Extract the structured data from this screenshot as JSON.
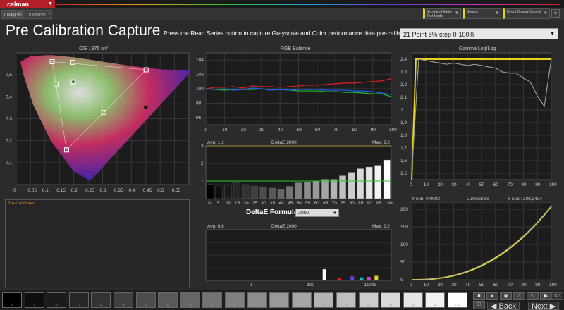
{
  "app": {
    "logo": "calman"
  },
  "tabs": [
    {
      "label": "meleg 40"
    },
    {
      "label": "meleg60"
    }
  ],
  "toolbar": {
    "meter": {
      "line1": "Simulated Meter",
      "line2": "Test Mode"
    },
    "source": {
      "line1": "Source"
    },
    "display": {
      "line1": "Direct Display Control"
    }
  },
  "page": {
    "title": "Pre Calibration Capture",
    "instructions": "Press the Read Series button to capture Grayscale and Color performance data pre-calibration.",
    "series": "21 Point 5% step 0-100%"
  },
  "notes": {
    "label": "Pre-Cal Notes:"
  },
  "formula": {
    "label": "DeltaE Formula",
    "value": "2000"
  },
  "colors": {
    "accent": "#e6d51c",
    "brand": "#b3202a",
    "panel": "#262626"
  },
  "chart_data": [
    {
      "id": "cie",
      "type": "scatter",
      "title": "CIE 1976 u'v'",
      "xlim": [
        0,
        0.6
      ],
      "ylim": [
        0,
        0.6
      ],
      "x_ticks": [
        "0",
        "0,05",
        "0,1",
        "0,15",
        "0,2",
        "0,25",
        "0,3",
        "0,35",
        "0,4",
        "0,45",
        "0,5",
        "0,55"
      ],
      "y_ticks": [
        "0,1",
        "0,2",
        "0,3",
        "0,4",
        "0,5"
      ],
      "targets": [
        {
          "u": 0.125,
          "v": 0.56
        },
        {
          "u": 0.175,
          "v": 0.158
        },
        {
          "u": 0.451,
          "v": 0.523
        },
        {
          "u": 0.197,
          "v": 0.557
        },
        {
          "u": 0.138,
          "v": 0.458
        },
        {
          "u": 0.304,
          "v": 0.329
        },
        {
          "u": 0.198,
          "v": 0.468
        }
      ],
      "white_point": {
        "u": 0.198,
        "v": 0.468
      },
      "measured": [
        {
          "u": 0.45,
          "v": 0.352
        }
      ]
    },
    {
      "id": "rgb",
      "type": "line",
      "title": "RGB Balance",
      "xlim": [
        0,
        100
      ],
      "ylim": [
        95,
        105
      ],
      "x_ticks": [
        "0",
        "10",
        "20",
        "30",
        "40",
        "50",
        "60",
        "70",
        "80",
        "90",
        "100"
      ],
      "y_ticks": [
        "96",
        "98",
        "100",
        "102",
        "104"
      ],
      "x": [
        0,
        5,
        10,
        15,
        20,
        25,
        30,
        35,
        40,
        45,
        50,
        55,
        60,
        65,
        70,
        75,
        80,
        85,
        90,
        95,
        100
      ],
      "series": [
        {
          "color": "#e02020",
          "values": [
            100,
            100.2,
            100.2,
            100.3,
            100.1,
            100.4,
            100.3,
            100.3,
            100.2,
            100.3,
            100.4,
            100.5,
            100.5,
            100.6,
            100.7,
            100.8,
            100.8,
            100.9,
            101.0,
            101.1,
            101.4
          ]
        },
        {
          "color": "#20c020",
          "values": [
            100,
            99.9,
            99.8,
            99.9,
            99.9,
            99.9,
            100.0,
            99.8,
            99.9,
            99.8,
            99.7,
            99.7,
            99.7,
            99.6,
            99.6,
            99.5,
            99.5,
            99.4,
            99.3,
            99.3,
            98.9
          ]
        },
        {
          "color": "#2060ff",
          "values": [
            100,
            99.9,
            100.0,
            99.8,
            99.9,
            100.1,
            100.0,
            99.8,
            99.9,
            99.8,
            99.9,
            99.9,
            99.9,
            99.8,
            99.8,
            99.8,
            99.7,
            99.7,
            99.6,
            99.4,
            99.2
          ]
        }
      ]
    },
    {
      "id": "gray-de",
      "type": "bar",
      "title": "DeltaE 2000",
      "avg_label": "Avg: 1,1",
      "max_label": "Max: 2,2",
      "ylim": [
        0,
        3
      ],
      "threshold": 1,
      "y_ticks": [
        "1",
        "2",
        "3"
      ],
      "categories": [
        "0",
        "5",
        "10",
        "15",
        "20",
        "25",
        "30",
        "35",
        "40",
        "45",
        "50",
        "55",
        "60",
        "65",
        "70",
        "75",
        "80",
        "85",
        "90",
        "95",
        "100"
      ],
      "values": [
        0.8,
        0.65,
        0.8,
        0.9,
        0.8,
        0.7,
        0.65,
        0.6,
        0.55,
        0.7,
        0.9,
        0.95,
        1.0,
        1.1,
        1.1,
        1.3,
        1.5,
        1.7,
        1.8,
        1.9,
        2.2
      ]
    },
    {
      "id": "color-de",
      "type": "bar",
      "title": "DeltaE 2000",
      "avg_label": "Avg: 0,8",
      "max_label": "Max: 2,2",
      "x_ticks": [
        "0",
        "100",
        "100%"
      ],
      "bars": [
        {
          "x": 0.63,
          "value": 2.2,
          "color": "#ffffff"
        },
        {
          "x": 0.71,
          "value": 0.5,
          "color": "#e02020"
        },
        {
          "x": 0.78,
          "value": 0.8,
          "color": "#6040e0"
        },
        {
          "x": 0.83,
          "value": 0.6,
          "color": "#20c0c0"
        },
        {
          "x": 0.87,
          "value": 0.7,
          "color": "#d040d0"
        },
        {
          "x": 0.91,
          "value": 0.9,
          "color": "#e6d51c"
        }
      ],
      "ylim": [
        0,
        10
      ]
    },
    {
      "id": "gamma",
      "type": "line",
      "title": "Gamma Log/Log",
      "xlim": [
        0,
        100
      ],
      "ylim": [
        1.45,
        2.45
      ],
      "target": 2.4,
      "x_ticks": [
        "0",
        "10",
        "20",
        "30",
        "40",
        "50",
        "60",
        "70",
        "80",
        "90",
        "100"
      ],
      "y_ticks": [
        "1,5",
        "1,6",
        "1,7",
        "1,8",
        "1,9",
        "2",
        "2,1",
        "2,2",
        "2,3",
        "2,4"
      ],
      "x": [
        0,
        5,
        10,
        15,
        20,
        25,
        30,
        35,
        40,
        45,
        50,
        55,
        60,
        65,
        70,
        75,
        80,
        85,
        90,
        95,
        100
      ],
      "measured": [
        1.5,
        2.4,
        2.39,
        2.38,
        2.37,
        2.36,
        2.37,
        2.36,
        2.35,
        2.36,
        2.35,
        2.34,
        2.33,
        2.3,
        2.29,
        2.29,
        2.25,
        2.22,
        2.11,
        2.03,
        2.4
      ]
    },
    {
      "id": "luminance",
      "type": "line",
      "title": "Luminance",
      "ymin_label": "Y Min: 0,0003",
      "ymax_label": "Y Max: 208,3434",
      "xlim": [
        0,
        100
      ],
      "ylim": [
        0,
        220
      ],
      "x_ticks": [
        "0",
        "10",
        "20",
        "30",
        "40",
        "50",
        "60",
        "70",
        "80",
        "90",
        "100"
      ],
      "y_ticks": [
        "0",
        "50",
        "100",
        "150",
        "200"
      ],
      "gamma": 2.4,
      "peak": 208.3434
    }
  ],
  "footer": {
    "swatches": [
      {
        "label": "0",
        "color": "#000000"
      },
      {
        "label": "5",
        "color": "#0d0d0d"
      },
      {
        "label": "10",
        "color": "#1a1a1a"
      },
      {
        "label": "15",
        "color": "#262626"
      },
      {
        "label": "20",
        "color": "#333333"
      },
      {
        "label": "25",
        "color": "#404040"
      },
      {
        "label": "30",
        "color": "#4d4d4d"
      },
      {
        "label": "35",
        "color": "#595959"
      },
      {
        "label": "40",
        "color": "#666666"
      },
      {
        "label": "45",
        "color": "#737373"
      },
      {
        "label": "50",
        "color": "#808080"
      },
      {
        "label": "55",
        "color": "#8c8c8c"
      },
      {
        "label": "60",
        "color": "#999999"
      },
      {
        "label": "65",
        "color": "#a6a6a6"
      },
      {
        "label": "70",
        "color": "#b3b3b3"
      },
      {
        "label": "75",
        "color": "#bfbfbf"
      },
      {
        "label": "80",
        "color": "#cccccc"
      },
      {
        "label": "85",
        "color": "#d9d9d9"
      },
      {
        "label": "90",
        "color": "#e6e6e6"
      },
      {
        "label": "95",
        "color": "#f2f2f2"
      },
      {
        "label": "100",
        "color": "#ffffff"
      }
    ],
    "back": "Back",
    "next": "Next",
    "counter": "123"
  }
}
